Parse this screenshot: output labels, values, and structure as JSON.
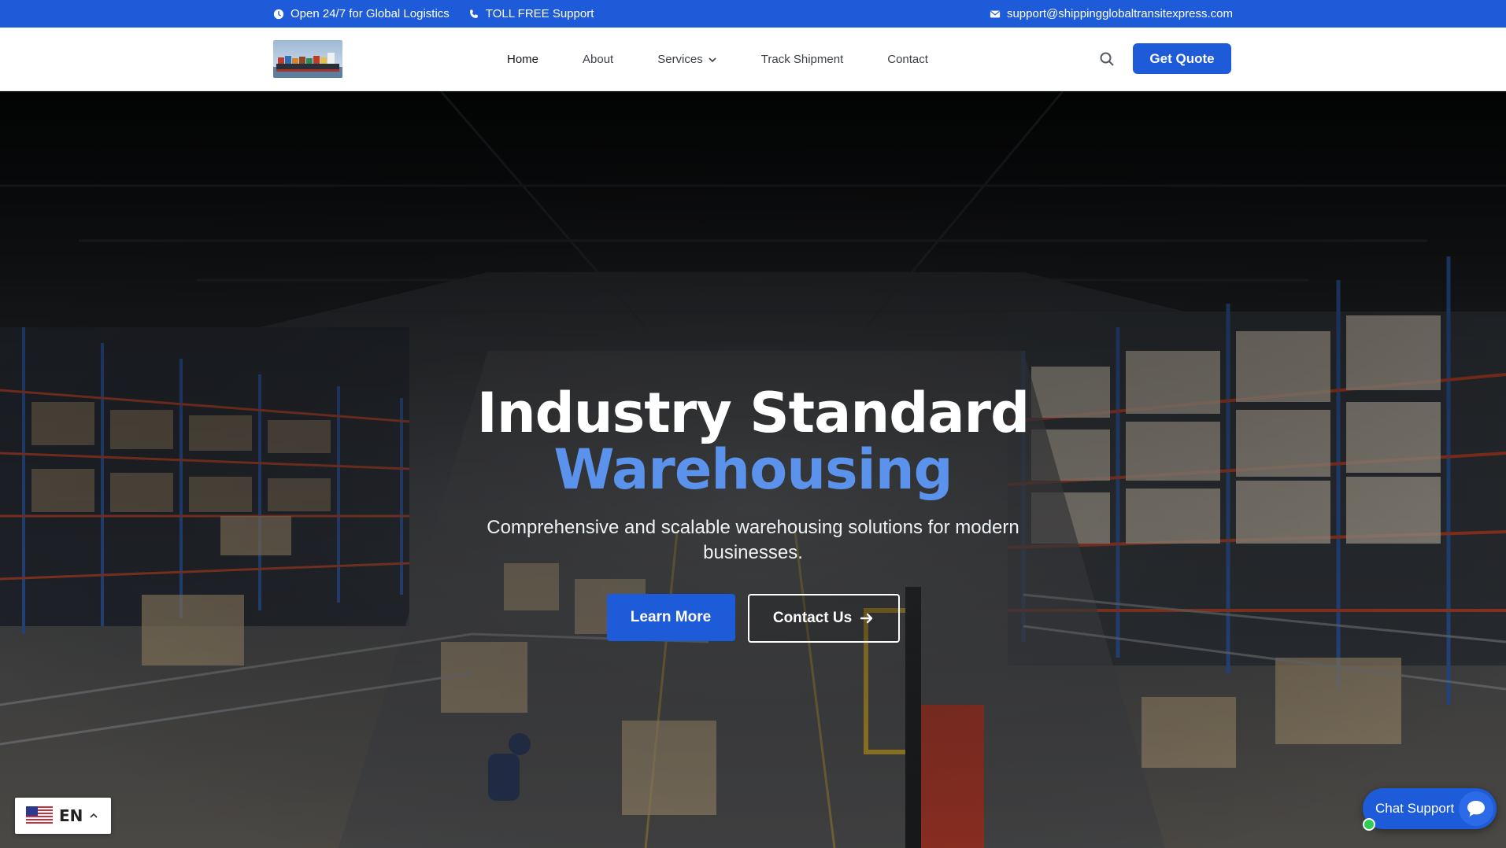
{
  "topbar": {
    "hours": "Open 24/7 for Global Logistics",
    "phone": "TOLL FREE Support",
    "email": "support@shippingglobaltransitexpress.com"
  },
  "header": {
    "nav": {
      "home": "Home",
      "about": "About",
      "services": "Services",
      "track": "Track Shipment",
      "contact": "Contact"
    },
    "quote_label": "Get Quote"
  },
  "hero": {
    "title_line1": "Industry Standard",
    "title_line2": "Warehousing",
    "subtitle": "Comprehensive and scalable warehousing solutions for modern businesses.",
    "learn_more": "Learn More",
    "contact_us": "Contact Us"
  },
  "language": {
    "code": "EN"
  },
  "chat": {
    "label": "Chat Support"
  },
  "colors": {
    "brand": "#1e5bd9",
    "accent_text": "#5b93ec",
    "online": "#2fcc55"
  },
  "icons": [
    "clock-icon",
    "phone-icon",
    "mail-icon",
    "search-icon",
    "chevron-down-icon",
    "arrow-right-icon",
    "us-flag-icon",
    "chevron-up-icon",
    "chat-bubble-icon"
  ]
}
